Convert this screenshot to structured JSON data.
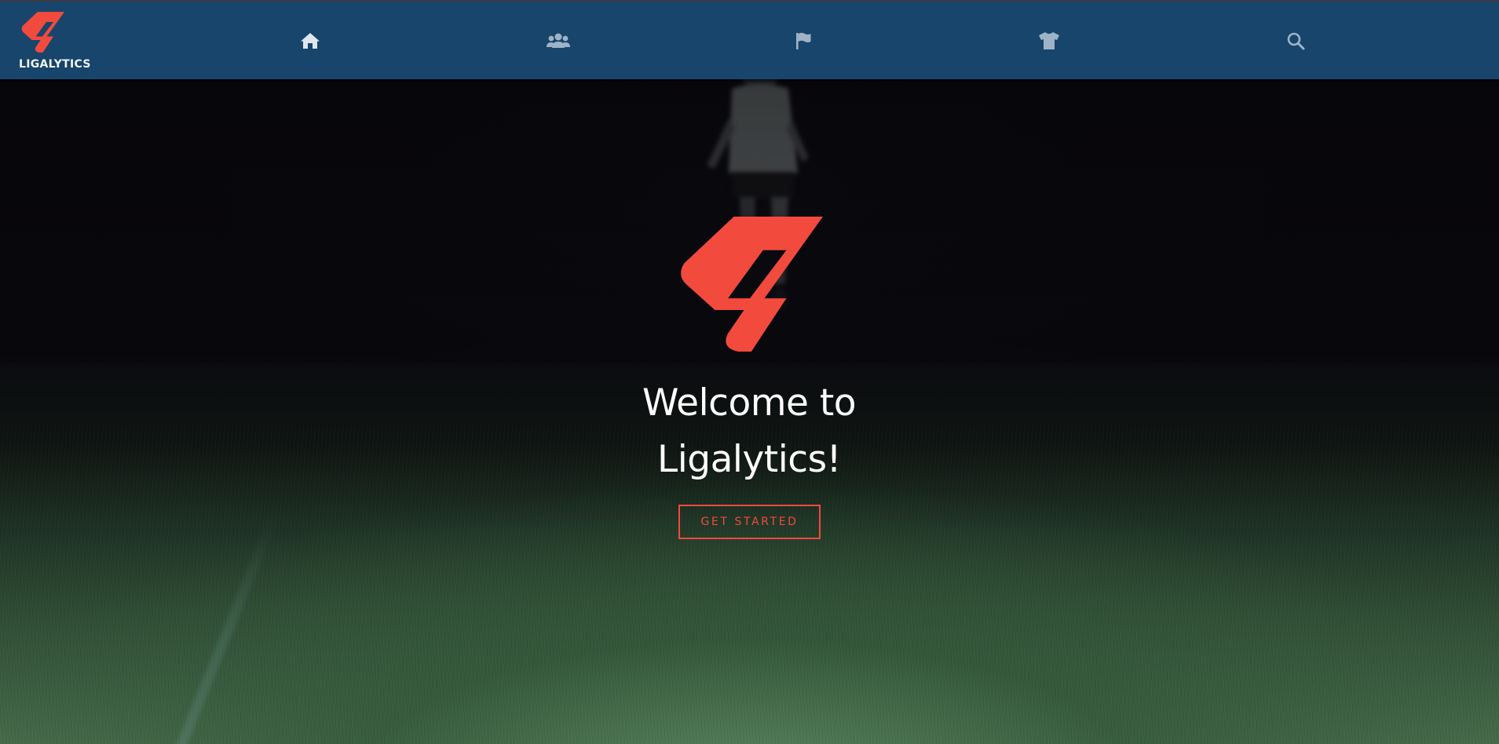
{
  "brand": {
    "name": "LIGALYTICS",
    "logo_icon": "laliga-logo-icon",
    "accent_color": "#f24a3d",
    "bar_color": "#17456b"
  },
  "nav": {
    "items": [
      {
        "name": "home",
        "icon": "home-icon",
        "active": true
      },
      {
        "name": "teams",
        "icon": "users-icon",
        "active": false
      },
      {
        "name": "leagues",
        "icon": "flag-icon",
        "active": false
      },
      {
        "name": "players",
        "icon": "shirt-icon",
        "active": false
      },
      {
        "name": "search",
        "icon": "search-icon",
        "active": false
      }
    ]
  },
  "hero": {
    "title_line1": "Welcome to",
    "title_line2": "Ligalytics!",
    "cta_label": "GET STARTED",
    "background": "night-football-pitch-photo"
  }
}
